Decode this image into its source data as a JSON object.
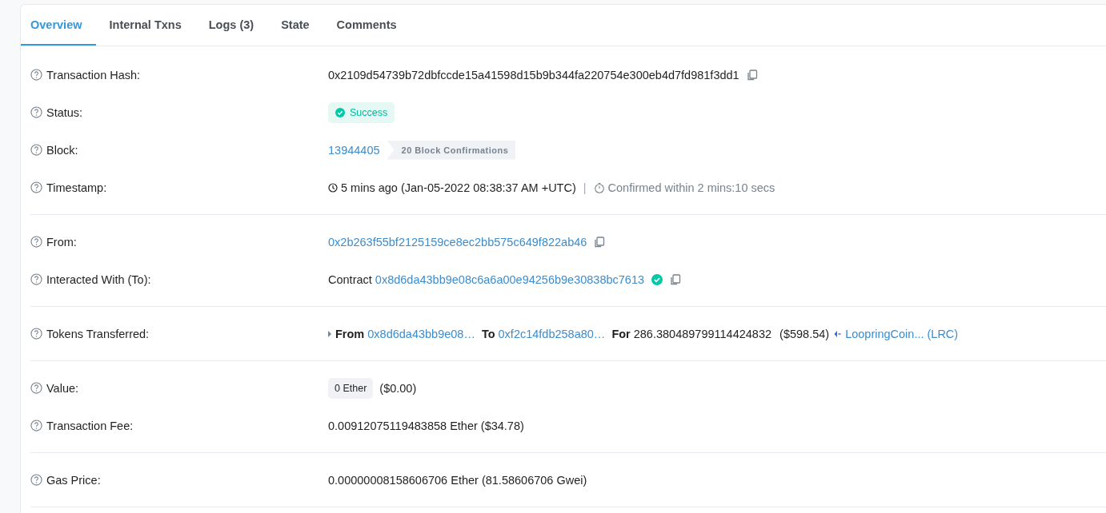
{
  "tabs": [
    {
      "label": "Overview",
      "selected": true
    },
    {
      "label": "Internal Txns",
      "selected": false
    },
    {
      "label": "Logs (3)",
      "selected": false
    },
    {
      "label": "State",
      "selected": false
    },
    {
      "label": "Comments",
      "selected": false
    }
  ],
  "groups": [
    {
      "rows": [
        {
          "kind": "hash",
          "label": "Transaction Hash:",
          "value": "0x2109d54739b72dbfccde15a41598d15b9b344fa220754e300eb4d7fd981f3dd1"
        },
        {
          "kind": "status",
          "label": "Status:",
          "value": "Success"
        },
        {
          "kind": "block",
          "label": "Block:",
          "value": "13944405",
          "confirmations": "20 Block Confirmations"
        },
        {
          "kind": "timestamp",
          "label": "Timestamp:",
          "value": "5 mins ago (Jan-05-2022 08:38:37 AM +UTC)",
          "separator": "|",
          "confirmed": "Confirmed within 2 mins:10 secs"
        }
      ]
    },
    {
      "rows": [
        {
          "kind": "address",
          "label": "From:",
          "value": "0x2b263f55bf2125159ce8ec2bb575c649f822ab46"
        },
        {
          "kind": "contract",
          "label": "Interacted With (To):",
          "prefix": "Contract",
          "value": "0x8d6da43bb9e08c6a6a00e94256b9e30838bc7613",
          "verified": true
        }
      ]
    },
    {
      "rows": [
        {
          "kind": "transfer",
          "label": "Tokens Transferred:",
          "from_label": "From",
          "from": "0x8d6da43bb9e08…",
          "to_label": "To",
          "to": "0xf2c14fdb258a80…",
          "for_label": "For",
          "amount": "286.380489799114424832",
          "usd": "($598.54)",
          "token": "LoopringCoin... (LRC)"
        }
      ]
    },
    {
      "rows": [
        {
          "kind": "value",
          "label": "Value:",
          "value": "0 Ether",
          "usd": "($0.00)"
        },
        {
          "kind": "text",
          "label": "Transaction Fee:",
          "value": "0.00912075119483858 Ether ($34.78)"
        }
      ]
    },
    {
      "rows": [
        {
          "kind": "text",
          "label": "Gas Price:",
          "value": "0.00000008158606706 Ether (81.58606706 Gwei)"
        }
      ]
    }
  ]
}
